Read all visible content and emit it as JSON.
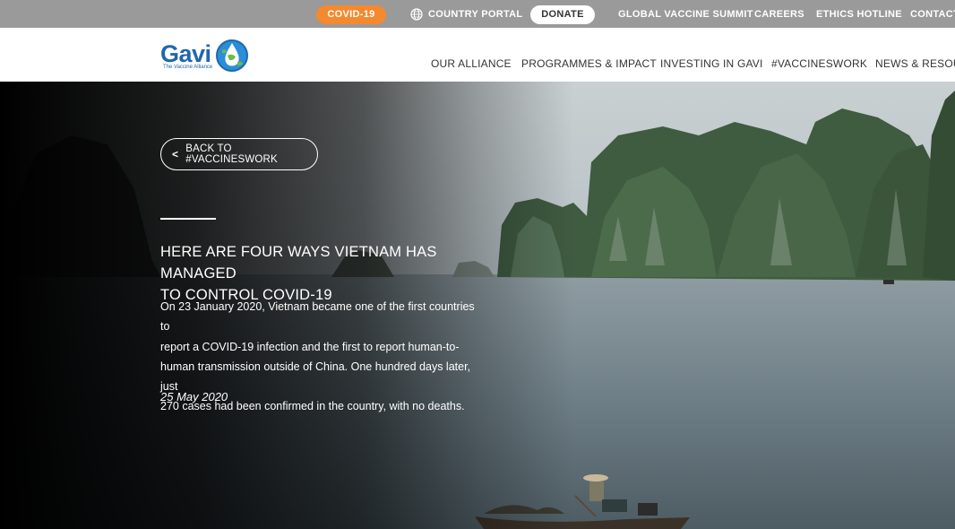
{
  "topbar": {
    "covid": "COVID-19",
    "country_portal": "COUNTRY PORTAL",
    "donate": "DONATE",
    "links": [
      "GLOBAL VACCINE SUMMIT",
      "CAREERS",
      "ETHICS HOTLINE",
      "CONTACT U"
    ]
  },
  "logo": {
    "name": "Gavi",
    "tagline": "The Vaccine Alliance"
  },
  "nav": [
    "OUR ALLIANCE",
    "PROGRAMMES & IMPACT",
    "INVESTING IN GAVI",
    "#VACCINESWORK",
    "NEWS & RESOURC"
  ],
  "hero": {
    "back_label": "BACK TO #VACCINESWORK",
    "headline_line1": "HERE ARE FOUR WAYS VIETNAM HAS MANAGED",
    "headline_line2": "TO CONTROL COVID-19",
    "summary_lines": [
      "On 23 January 2020, Vietnam became one of the first countries to",
      "report a COVID-19 infection and the first to report human-to-",
      "human transmission outside of China. One hundred days later, just",
      "270 cases had been confirmed in the country, with no deaths."
    ],
    "date": "25 May 2020"
  },
  "colors": {
    "topbar_bg": "#9a9a9a",
    "covid_pill": "#f4892f",
    "brand_blue": "#1f67ad"
  }
}
